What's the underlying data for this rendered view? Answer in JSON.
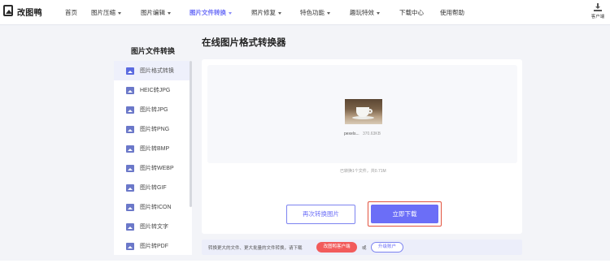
{
  "header": {
    "logo_text": "改图鸭",
    "nav": [
      {
        "label": "首页",
        "active": false,
        "caret": false
      },
      {
        "label": "图片压缩",
        "active": false,
        "caret": true
      },
      {
        "label": "图片编辑",
        "active": false,
        "caret": true
      },
      {
        "label": "图片文件转换",
        "active": true,
        "caret": true
      },
      {
        "label": "照片修复",
        "active": false,
        "caret": true
      },
      {
        "label": "特色功能",
        "active": false,
        "caret": true
      },
      {
        "label": "趣玩特效",
        "active": false,
        "caret": true
      },
      {
        "label": "下载中心",
        "active": false,
        "caret": false
      },
      {
        "label": "使用帮助",
        "active": false,
        "caret": false
      }
    ],
    "client_label": "客户端"
  },
  "sidebar": {
    "title": "图片文件转换",
    "items": [
      {
        "label": "图片格式转换",
        "active": true
      },
      {
        "label": "HEIC转JPG",
        "active": false
      },
      {
        "label": "图片转JPG",
        "active": false
      },
      {
        "label": "图片转PNG",
        "active": false
      },
      {
        "label": "图片转BMP",
        "active": false
      },
      {
        "label": "图片转WEBP",
        "active": false
      },
      {
        "label": "图片转GIF",
        "active": false
      },
      {
        "label": "图片转ICON",
        "active": false
      },
      {
        "label": "图片转文字",
        "active": false
      },
      {
        "label": "图片转PDF",
        "active": false
      }
    ]
  },
  "main": {
    "title": "在线图片格式转换器",
    "file": {
      "name": "pexels...",
      "size": "370.63KB"
    },
    "summary": "已转换1个文件，共0.71M",
    "again_button": "再次转换图片",
    "download_button": "立即下载"
  },
  "footer": {
    "text": "转换更大的文件、更大批量的文件转换，请下载",
    "client_button": "改图鸭客户端",
    "or": "或",
    "upgrade_button": "升级账户"
  },
  "colors": {
    "accent": "#6b6ef7",
    "highlight_border": "#e2533f",
    "client_button": "#f25b5b"
  }
}
